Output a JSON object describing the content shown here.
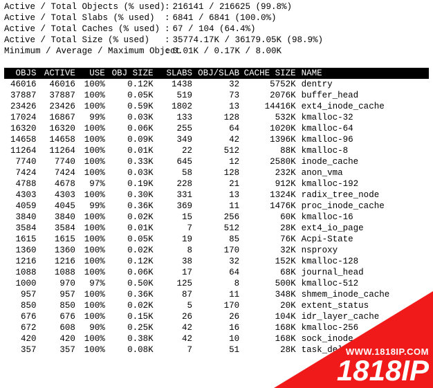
{
  "summary": [
    {
      "label": "Active / Total Objects (% used)",
      "value": "216141 / 216625 (99.8%)"
    },
    {
      "label": "Active / Total Slabs (% used)",
      "value": "6841 / 6841 (100.0%)"
    },
    {
      "label": "Active / Total Caches (% used)",
      "value": "67 / 104 (64.4%)"
    },
    {
      "label": "Active / Total Size (% used)",
      "value": "35774.17K / 36179.05K (98.9%)"
    },
    {
      "label": "Minimum / Average / Maximum Object",
      "value": "0.01K / 0.17K / 8.00K"
    }
  ],
  "columns": {
    "objs": "OBJS",
    "active": "ACTIVE",
    "use": "USE",
    "objsize": "OBJ SIZE",
    "slabs": "SLABS",
    "objslab": "OBJ/SLAB",
    "csize": "CACHE SIZE",
    "name": "NAME"
  },
  "rows": [
    {
      "objs": "46016",
      "active": "46016",
      "use": "100%",
      "objsize": "0.12K",
      "slabs": "1438",
      "objslab": "32",
      "csize": "5752K",
      "name": "dentry"
    },
    {
      "objs": "37887",
      "active": "37887",
      "use": "100%",
      "objsize": "0.05K",
      "slabs": "519",
      "objslab": "73",
      "csize": "2076K",
      "name": "buffer_head"
    },
    {
      "objs": "23426",
      "active": "23426",
      "use": "100%",
      "objsize": "0.59K",
      "slabs": "1802",
      "objslab": "13",
      "csize": "14416K",
      "name": "ext4_inode_cache"
    },
    {
      "objs": "17024",
      "active": "16867",
      "use": "99%",
      "objsize": "0.03K",
      "slabs": "133",
      "objslab": "128",
      "csize": "532K",
      "name": "kmalloc-32"
    },
    {
      "objs": "16320",
      "active": "16320",
      "use": "100%",
      "objsize": "0.06K",
      "slabs": "255",
      "objslab": "64",
      "csize": "1020K",
      "name": "kmalloc-64"
    },
    {
      "objs": "14658",
      "active": "14658",
      "use": "100%",
      "objsize": "0.09K",
      "slabs": "349",
      "objslab": "42",
      "csize": "1396K",
      "name": "kmalloc-96"
    },
    {
      "objs": "11264",
      "active": "11264",
      "use": "100%",
      "objsize": "0.01K",
      "slabs": "22",
      "objslab": "512",
      "csize": "88K",
      "name": "kmalloc-8"
    },
    {
      "objs": "7740",
      "active": "7740",
      "use": "100%",
      "objsize": "0.33K",
      "slabs": "645",
      "objslab": "12",
      "csize": "2580K",
      "name": "inode_cache"
    },
    {
      "objs": "7424",
      "active": "7424",
      "use": "100%",
      "objsize": "0.03K",
      "slabs": "58",
      "objslab": "128",
      "csize": "232K",
      "name": "anon_vma"
    },
    {
      "objs": "4788",
      "active": "4678",
      "use": "97%",
      "objsize": "0.19K",
      "slabs": "228",
      "objslab": "21",
      "csize": "912K",
      "name": "kmalloc-192"
    },
    {
      "objs": "4303",
      "active": "4303",
      "use": "100%",
      "objsize": "0.30K",
      "slabs": "331",
      "objslab": "13",
      "csize": "1324K",
      "name": "radix_tree_node"
    },
    {
      "objs": "4059",
      "active": "4045",
      "use": "99%",
      "objsize": "0.36K",
      "slabs": "369",
      "objslab": "11",
      "csize": "1476K",
      "name": "proc_inode_cache"
    },
    {
      "objs": "3840",
      "active": "3840",
      "use": "100%",
      "objsize": "0.02K",
      "slabs": "15",
      "objslab": "256",
      "csize": "60K",
      "name": "kmalloc-16"
    },
    {
      "objs": "3584",
      "active": "3584",
      "use": "100%",
      "objsize": "0.01K",
      "slabs": "7",
      "objslab": "512",
      "csize": "28K",
      "name": "ext4_io_page"
    },
    {
      "objs": "1615",
      "active": "1615",
      "use": "100%",
      "objsize": "0.05K",
      "slabs": "19",
      "objslab": "85",
      "csize": "76K",
      "name": "Acpi-State"
    },
    {
      "objs": "1360",
      "active": "1360",
      "use": "100%",
      "objsize": "0.02K",
      "slabs": "8",
      "objslab": "170",
      "csize": "32K",
      "name": "nsproxy"
    },
    {
      "objs": "1216",
      "active": "1216",
      "use": "100%",
      "objsize": "0.12K",
      "slabs": "38",
      "objslab": "32",
      "csize": "152K",
      "name": "kmalloc-128"
    },
    {
      "objs": "1088",
      "active": "1088",
      "use": "100%",
      "objsize": "0.06K",
      "slabs": "17",
      "objslab": "64",
      "csize": "68K",
      "name": "journal_head"
    },
    {
      "objs": "1000",
      "active": "970",
      "use": "97%",
      "objsize": "0.50K",
      "slabs": "125",
      "objslab": "8",
      "csize": "500K",
      "name": "kmalloc-512"
    },
    {
      "objs": "957",
      "active": "957",
      "use": "100%",
      "objsize": "0.36K",
      "slabs": "87",
      "objslab": "11",
      "csize": "348K",
      "name": "shmem_inode_cache"
    },
    {
      "objs": "850",
      "active": "850",
      "use": "100%",
      "objsize": "0.02K",
      "slabs": "5",
      "objslab": "170",
      "csize": "20K",
      "name": "extent_status"
    },
    {
      "objs": "676",
      "active": "676",
      "use": "100%",
      "objsize": "0.15K",
      "slabs": "26",
      "objslab": "26",
      "csize": "104K",
      "name": "idr_layer_cache"
    },
    {
      "objs": "672",
      "active": "608",
      "use": "90%",
      "objsize": "0.25K",
      "slabs": "42",
      "objslab": "16",
      "csize": "168K",
      "name": "kmalloc-256"
    },
    {
      "objs": "420",
      "active": "420",
      "use": "100%",
      "objsize": "0.38K",
      "slabs": "42",
      "objslab": "10",
      "csize": "168K",
      "name": "sock_inode_cache"
    },
    {
      "objs": "357",
      "active": "357",
      "use": "100%",
      "objsize": "0.08K",
      "slabs": "7",
      "objslab": "51",
      "csize": "28K",
      "name": "task_delay_info"
    }
  ],
  "watermark": {
    "url": "WWW.1818IP.COM",
    "big": "1818IP"
  }
}
